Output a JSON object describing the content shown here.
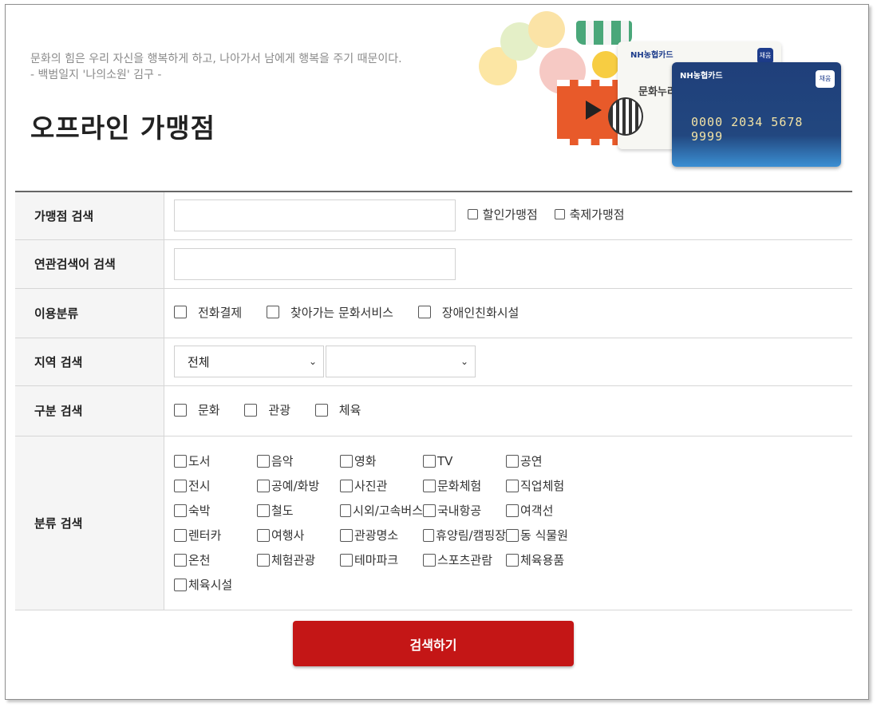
{
  "header": {
    "quote_line1": "문화의 힘은 우리 자신을 행복하게 하고, 나아가서 남에게 행복을 주기 때문이다.",
    "quote_line2": "- 백범일지 '나의소원' 김구 -",
    "title": "오프라인 가맹점"
  },
  "illustration": {
    "card_front": {
      "brand": "NH농협카드",
      "badge": "채움",
      "number": "0000 2034 5678 9999"
    },
    "card_back": {
      "brand": "NH농협카드",
      "badge": "채움",
      "text": "문화누리"
    }
  },
  "form": {
    "store_search": {
      "label": "가맹점 검색",
      "input_value": "",
      "options": [
        "할인가맹점",
        "축제가맹점"
      ]
    },
    "keyword_search": {
      "label": "연관검색어 검색",
      "input_value": ""
    },
    "usage_category": {
      "label": "이용분류",
      "options": [
        "전화결제",
        "찾아가는 문화서비스",
        "장애인친화시설"
      ]
    },
    "region_search": {
      "label": "지역 검색",
      "select1_value": "전체",
      "select2_value": ""
    },
    "type_search": {
      "label": "구분 검색",
      "options": [
        "문화",
        "관광",
        "체육"
      ]
    },
    "category_search": {
      "label": "분류 검색",
      "options": [
        "도서",
        "음악",
        "영화",
        "TV",
        "공연",
        "전시",
        "공예/화방",
        "사진관",
        "문화체험",
        "직업체험",
        "숙박",
        "철도",
        "시외/고속버스",
        "국내항공",
        "여객선",
        "렌터카",
        "여행사",
        "관광명소",
        "휴양림/캠핑장",
        "동 식물원",
        "온천",
        "체험관광",
        "테마파크",
        "스포츠관람",
        "체육용품",
        "체육시설"
      ]
    }
  },
  "submit_label": "검색하기",
  "colors": {
    "submit": "#c41616",
    "label_bg": "#f5f5f5"
  }
}
